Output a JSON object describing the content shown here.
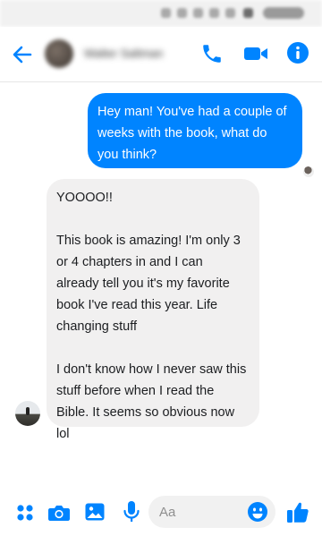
{
  "header": {
    "contact_name": "Walter Saltman"
  },
  "messages": [
    {
      "direction": "outgoing",
      "text": "Hey man! You've had a couple of\nweeks with the book, what do\nyou think?"
    },
    {
      "direction": "incoming",
      "text": "YOOOO!!\n\nThis book is amazing! I'm only 3\nor 4 chapters in and I can\nalready tell you it's my favorite\nbook I've read this year. Life\nchanging stuff\n\nI don't know how I never saw this\nstuff before when I read the\nBible. It seems so obvious now lol"
    }
  ],
  "composer": {
    "placeholder": "Aa"
  },
  "colors": {
    "accent": "#0084ff",
    "incoming_bubble": "#f1f0f0",
    "outgoing_text": "#ffffff"
  },
  "icons": {
    "header": [
      "back-arrow-icon",
      "phone-icon",
      "video-camera-icon",
      "info-icon"
    ],
    "composer": [
      "apps-icon",
      "camera-icon",
      "gallery-icon",
      "microphone-icon",
      "emoji-icon",
      "thumbs-up-icon"
    ]
  }
}
